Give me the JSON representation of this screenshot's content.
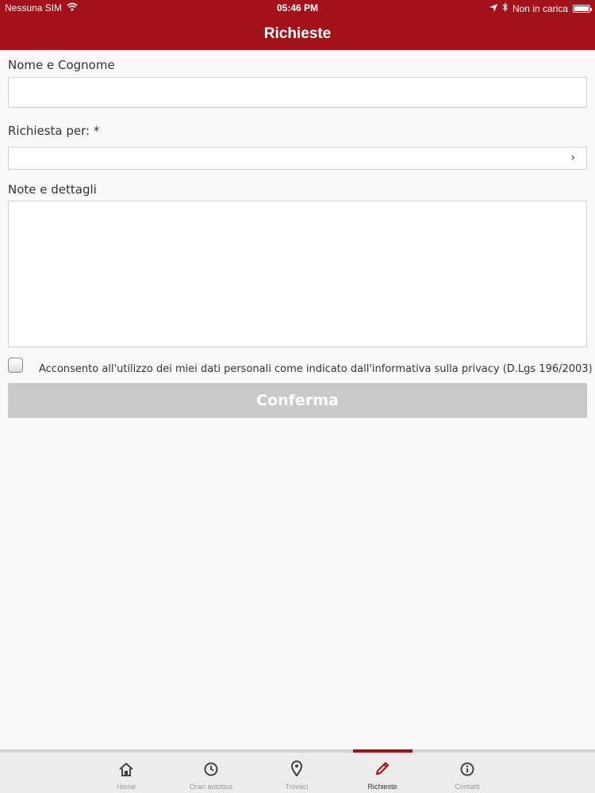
{
  "status_bar": {
    "carrier": "Nessuna SIM",
    "time": "05:46 PM",
    "charging": "Non in carica"
  },
  "header": {
    "title": "Richieste"
  },
  "form": {
    "name_label": "Nome e Cognome",
    "name_value": "",
    "request_label": "Richiesta per: *",
    "request_value": "",
    "notes_label": "Note e dettagli",
    "notes_value": "",
    "consent_text": "Acconsento all'utilizzo dei miei dati personali come indicato dall'informativa sulla privacy (D.Lgs 196/2003)",
    "consent_checked": false,
    "confirm_label": "Conferma"
  },
  "tabs": [
    {
      "label": "Home",
      "icon": "home-icon"
    },
    {
      "label": "Orari autobus",
      "icon": "clock-icon"
    },
    {
      "label": "Trovaci",
      "icon": "location-pin-icon"
    },
    {
      "label": "Richieste",
      "icon": "pencil-icon",
      "active": true
    },
    {
      "label": "Contatti",
      "icon": "info-icon"
    }
  ],
  "colors": {
    "brand": "#a3111a",
    "background": "#fbf9fb",
    "button_disabled": "#c9c9c9"
  }
}
